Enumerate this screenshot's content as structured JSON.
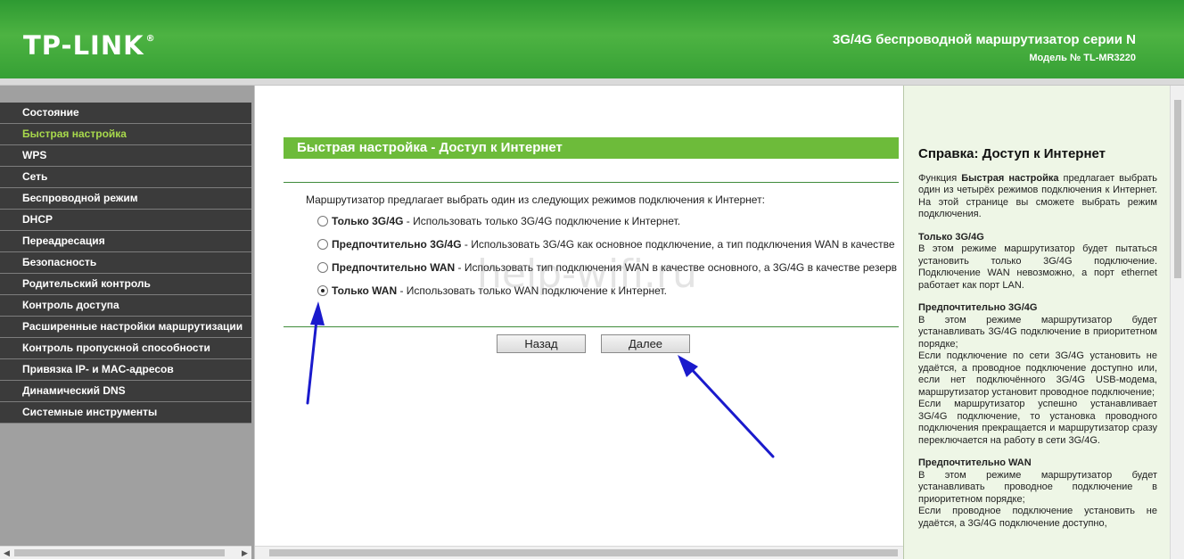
{
  "header": {
    "logo": "TP-LINK",
    "logo_reg": "®",
    "title": "3G/4G беспроводной маршрутизатор серии N",
    "model": "Модель № TL-MR3220"
  },
  "sidebar": {
    "items": [
      {
        "label": "Состояние"
      },
      {
        "label": "Быстрая настройка"
      },
      {
        "label": "WPS"
      },
      {
        "label": "Сеть"
      },
      {
        "label": "Беспроводной режим"
      },
      {
        "label": "DHCP"
      },
      {
        "label": "Переадресация"
      },
      {
        "label": "Безопасность"
      },
      {
        "label": "Родительский контроль"
      },
      {
        "label": "Контроль доступа"
      },
      {
        "label": "Расширенные настройки маршрутизации"
      },
      {
        "label": "Контроль пропускной способности"
      },
      {
        "label": "Привязка IP- и MAC-адресов"
      },
      {
        "label": "Динамический DNS"
      },
      {
        "label": "Системные инструменты"
      }
    ]
  },
  "main": {
    "title": "Быстрая настройка - Доступ к Интернет",
    "intro": "Маршрутизатор предлагает выбрать один из следующих режимов подключения к Интернет:",
    "options": [
      {
        "name": "Только 3G/4G",
        "desc": " - Использовать только 3G/4G подключение к Интернет."
      },
      {
        "name": "Предпочтительно 3G/4G",
        "desc": " - Использовать 3G/4G как основное подключение, а тип подключения WAN в качестве"
      },
      {
        "name": "Предпочтительно WAN",
        "desc": " - Использовать тип подключения WAN в качестве основного, а 3G/4G в качестве резерв"
      },
      {
        "name": "Только WAN",
        "desc": " - Использовать только WAN подключение к Интернет."
      }
    ],
    "back_button": "Назад",
    "next_button": "Далее"
  },
  "watermark": "help-wifi.ru",
  "help": {
    "title": "Справка: Доступ к Интернет",
    "intro_pre": "Функция ",
    "intro_bold": "Быстрая настройка",
    "intro_post": " предлагает выбрать один из четырёх режимов подключения к Интернет. На этой странице вы сможете выбрать режим подключения.",
    "sections": [
      {
        "title": "Только 3G/4G",
        "paragraphs": [
          "В этом режиме маршрутизатор будет пытаться установить только 3G/4G подключение. Подключение WAN невозможно, а порт ethernet работает как порт LAN."
        ]
      },
      {
        "title": "Предпочтительно 3G/4G",
        "paragraphs": [
          "В этом режиме маршрутизатор будет устанавливать 3G/4G подключение в приоритетном порядке;",
          "Если подключение по сети 3G/4G установить не удаётся, а проводное подключение доступно или, если нет подключённого 3G/4G USB-модема, маршрутизатор установит проводное подключение;",
          "Если маршрутизатор успешно устанавливает 3G/4G подключение, то установка проводного подключения прекращается и маршрутизатор сразу переключается на работу в сети 3G/4G."
        ]
      },
      {
        "title": "Предпочтительно WAN",
        "paragraphs": [
          "В этом режиме маршрутизатор будет устанавливать проводное подключение в приоритетном порядке;",
          "Если проводное подключение установить не удаётся, а 3G/4G подключение доступно,"
        ]
      }
    ]
  },
  "colors": {
    "header_green": "#3fab3b",
    "menu_bg": "#3b3b3b",
    "menu_active": "#a8d94c",
    "title_bar": "#6dbb3a",
    "help_bg": "#eef6e6",
    "arrow": "#1a1acc"
  }
}
